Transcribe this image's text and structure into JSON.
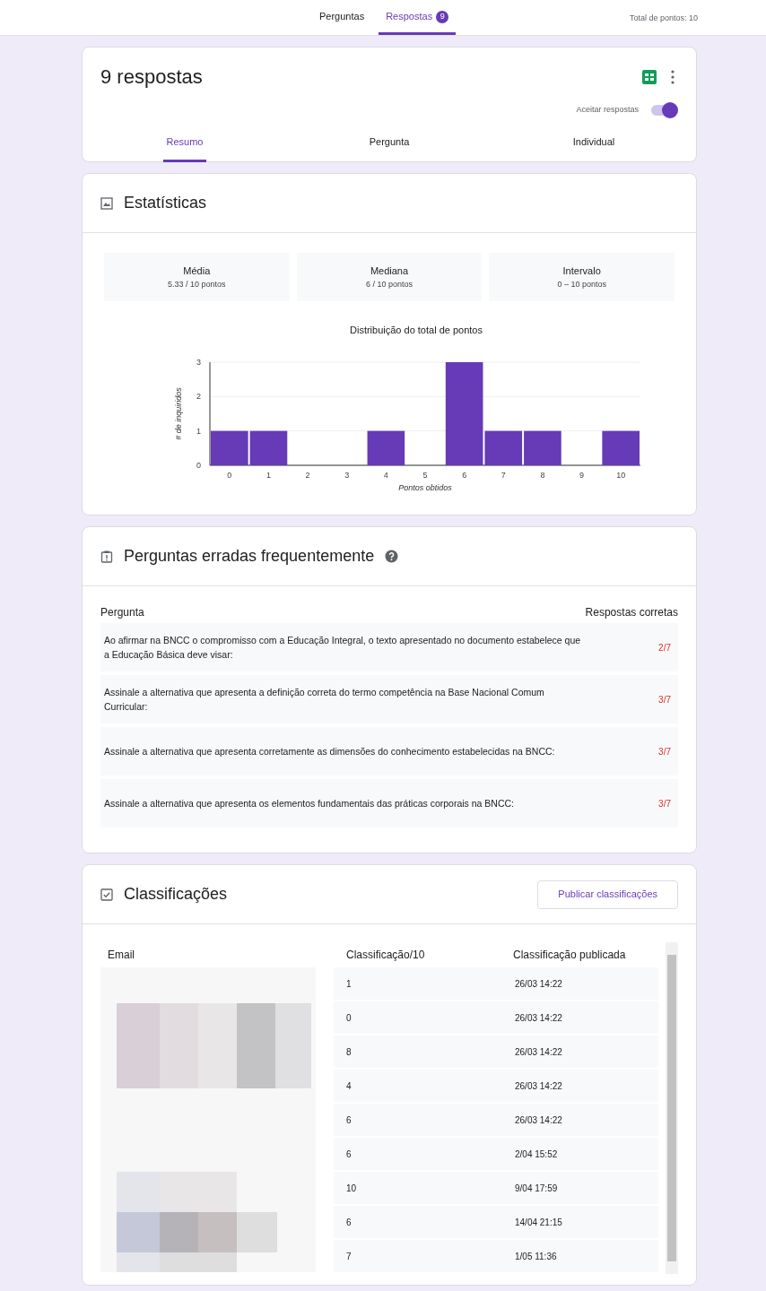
{
  "top_tabs": [
    {
      "label": "Perguntas",
      "selected": false
    },
    {
      "label": "Respostas",
      "selected": true,
      "badge": "9"
    }
  ],
  "total_points": "Total de pontos: 10",
  "summary": {
    "title": "9 respostas",
    "accept_label": "Aceitar respostas",
    "accept_on": true,
    "tabs": [
      {
        "label": "Resumo",
        "selected": true
      },
      {
        "label": "Pergunta",
        "selected": false
      },
      {
        "label": "Individual",
        "selected": false
      }
    ]
  },
  "stats": {
    "title": "Estatísticas",
    "tiles": [
      {
        "label": "Média",
        "value": "5.33 / 10 pontos"
      },
      {
        "label": "Mediana",
        "value": "6 / 10 pontos"
      },
      {
        "label": "Intervalo",
        "value": "0 – 10 pontos"
      }
    ],
    "chart_data": {
      "type": "bar",
      "title": "Distribuição do total de pontos",
      "xlabel": "Pontos obtidos",
      "ylabel": "# de inquiridos",
      "categories": [
        "0",
        "1",
        "2",
        "3",
        "4",
        "5",
        "6",
        "7",
        "8",
        "9",
        "10"
      ],
      "series": [
        {
          "color": "#673ab7",
          "values": [
            1,
            1,
            0,
            0,
            1,
            0,
            3,
            1,
            1,
            0,
            1
          ]
        }
      ],
      "ylim": [
        0,
        3
      ],
      "yticks": [
        0,
        1,
        2,
        3
      ]
    }
  },
  "missed": {
    "title": "Perguntas erradas frequentemente",
    "col_question": "Pergunta",
    "col_correct": "Respostas corretas",
    "rows": [
      {
        "question": "Ao afirmar na BNCC o compromisso com a Educação Integral, o texto apresentado no documento estabelece que a Educação Básica deve visar:",
        "correct": "2/7"
      },
      {
        "question": "Assinale a alternativa que apresenta a definição correta do termo competência na Base Nacional Comum Curricular:",
        "correct": "3/7"
      },
      {
        "question": "Assinale a alternativa que apresenta corretamente as dimensões do conhecimento estabelecidas na BNCC:",
        "correct": "3/7"
      },
      {
        "question": "Assinale a alternativa que apresenta os elementos fundamentais das práticas corporais na BNCC:",
        "correct": "3/7"
      }
    ]
  },
  "grades": {
    "title": "Classificações",
    "publish_button": "Publicar classificações",
    "columns": [
      "Email",
      "Classificação/10",
      "Classificação publicada"
    ],
    "rows": [
      {
        "grade": "1",
        "published": "26/03 14:22"
      },
      {
        "grade": "0",
        "published": "26/03 14:22"
      },
      {
        "grade": "8",
        "published": "26/03 14:22"
      },
      {
        "grade": "4",
        "published": "26/03 14:22"
      },
      {
        "grade": "6",
        "published": "26/03 14:22"
      },
      {
        "grade": "6",
        "published": "2/04 15:52"
      },
      {
        "grade": "10",
        "published": "9/04 17:59"
      },
      {
        "grade": "6",
        "published": "14/04 21:15"
      },
      {
        "grade": "7",
        "published": "1/05 11:36"
      }
    ]
  }
}
